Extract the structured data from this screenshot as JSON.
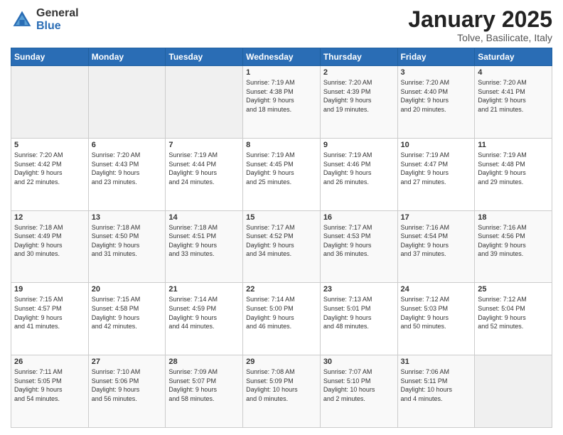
{
  "header": {
    "logo_general": "General",
    "logo_blue": "Blue",
    "title": "January 2025",
    "location": "Tolve, Basilicate, Italy"
  },
  "weekdays": [
    "Sunday",
    "Monday",
    "Tuesday",
    "Wednesday",
    "Thursday",
    "Friday",
    "Saturday"
  ],
  "weeks": [
    [
      {
        "day": "",
        "info": ""
      },
      {
        "day": "",
        "info": ""
      },
      {
        "day": "",
        "info": ""
      },
      {
        "day": "1",
        "info": "Sunrise: 7:19 AM\nSunset: 4:38 PM\nDaylight: 9 hours\nand 18 minutes."
      },
      {
        "day": "2",
        "info": "Sunrise: 7:20 AM\nSunset: 4:39 PM\nDaylight: 9 hours\nand 19 minutes."
      },
      {
        "day": "3",
        "info": "Sunrise: 7:20 AM\nSunset: 4:40 PM\nDaylight: 9 hours\nand 20 minutes."
      },
      {
        "day": "4",
        "info": "Sunrise: 7:20 AM\nSunset: 4:41 PM\nDaylight: 9 hours\nand 21 minutes."
      }
    ],
    [
      {
        "day": "5",
        "info": "Sunrise: 7:20 AM\nSunset: 4:42 PM\nDaylight: 9 hours\nand 22 minutes."
      },
      {
        "day": "6",
        "info": "Sunrise: 7:20 AM\nSunset: 4:43 PM\nDaylight: 9 hours\nand 23 minutes."
      },
      {
        "day": "7",
        "info": "Sunrise: 7:19 AM\nSunset: 4:44 PM\nDaylight: 9 hours\nand 24 minutes."
      },
      {
        "day": "8",
        "info": "Sunrise: 7:19 AM\nSunset: 4:45 PM\nDaylight: 9 hours\nand 25 minutes."
      },
      {
        "day": "9",
        "info": "Sunrise: 7:19 AM\nSunset: 4:46 PM\nDaylight: 9 hours\nand 26 minutes."
      },
      {
        "day": "10",
        "info": "Sunrise: 7:19 AM\nSunset: 4:47 PM\nDaylight: 9 hours\nand 27 minutes."
      },
      {
        "day": "11",
        "info": "Sunrise: 7:19 AM\nSunset: 4:48 PM\nDaylight: 9 hours\nand 29 minutes."
      }
    ],
    [
      {
        "day": "12",
        "info": "Sunrise: 7:18 AM\nSunset: 4:49 PM\nDaylight: 9 hours\nand 30 minutes."
      },
      {
        "day": "13",
        "info": "Sunrise: 7:18 AM\nSunset: 4:50 PM\nDaylight: 9 hours\nand 31 minutes."
      },
      {
        "day": "14",
        "info": "Sunrise: 7:18 AM\nSunset: 4:51 PM\nDaylight: 9 hours\nand 33 minutes."
      },
      {
        "day": "15",
        "info": "Sunrise: 7:17 AM\nSunset: 4:52 PM\nDaylight: 9 hours\nand 34 minutes."
      },
      {
        "day": "16",
        "info": "Sunrise: 7:17 AM\nSunset: 4:53 PM\nDaylight: 9 hours\nand 36 minutes."
      },
      {
        "day": "17",
        "info": "Sunrise: 7:16 AM\nSunset: 4:54 PM\nDaylight: 9 hours\nand 37 minutes."
      },
      {
        "day": "18",
        "info": "Sunrise: 7:16 AM\nSunset: 4:56 PM\nDaylight: 9 hours\nand 39 minutes."
      }
    ],
    [
      {
        "day": "19",
        "info": "Sunrise: 7:15 AM\nSunset: 4:57 PM\nDaylight: 9 hours\nand 41 minutes."
      },
      {
        "day": "20",
        "info": "Sunrise: 7:15 AM\nSunset: 4:58 PM\nDaylight: 9 hours\nand 42 minutes."
      },
      {
        "day": "21",
        "info": "Sunrise: 7:14 AM\nSunset: 4:59 PM\nDaylight: 9 hours\nand 44 minutes."
      },
      {
        "day": "22",
        "info": "Sunrise: 7:14 AM\nSunset: 5:00 PM\nDaylight: 9 hours\nand 46 minutes."
      },
      {
        "day": "23",
        "info": "Sunrise: 7:13 AM\nSunset: 5:01 PM\nDaylight: 9 hours\nand 48 minutes."
      },
      {
        "day": "24",
        "info": "Sunrise: 7:12 AM\nSunset: 5:03 PM\nDaylight: 9 hours\nand 50 minutes."
      },
      {
        "day": "25",
        "info": "Sunrise: 7:12 AM\nSunset: 5:04 PM\nDaylight: 9 hours\nand 52 minutes."
      }
    ],
    [
      {
        "day": "26",
        "info": "Sunrise: 7:11 AM\nSunset: 5:05 PM\nDaylight: 9 hours\nand 54 minutes."
      },
      {
        "day": "27",
        "info": "Sunrise: 7:10 AM\nSunset: 5:06 PM\nDaylight: 9 hours\nand 56 minutes."
      },
      {
        "day": "28",
        "info": "Sunrise: 7:09 AM\nSunset: 5:07 PM\nDaylight: 9 hours\nand 58 minutes."
      },
      {
        "day": "29",
        "info": "Sunrise: 7:08 AM\nSunset: 5:09 PM\nDaylight: 10 hours\nand 0 minutes."
      },
      {
        "day": "30",
        "info": "Sunrise: 7:07 AM\nSunset: 5:10 PM\nDaylight: 10 hours\nand 2 minutes."
      },
      {
        "day": "31",
        "info": "Sunrise: 7:06 AM\nSunset: 5:11 PM\nDaylight: 10 hours\nand 4 minutes."
      },
      {
        "day": "",
        "info": ""
      }
    ]
  ]
}
